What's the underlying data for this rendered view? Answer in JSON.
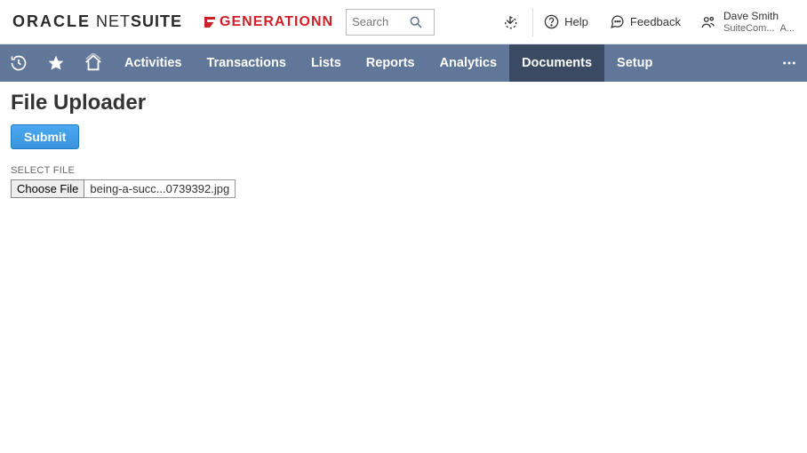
{
  "header": {
    "brand_oracle": "ORACLE",
    "brand_net": "NET",
    "brand_suite": "SUITE",
    "brand_partner": "GENERATIONN",
    "search_placeholder": "Search",
    "help_label": "Help",
    "feedback_label": "Feedback",
    "user_name": "Dave Smith",
    "user_company": "SuiteCom...",
    "user_role": "A..."
  },
  "nav": {
    "items": [
      {
        "label": "Activities",
        "active": false
      },
      {
        "label": "Transactions",
        "active": false
      },
      {
        "label": "Lists",
        "active": false
      },
      {
        "label": "Reports",
        "active": false
      },
      {
        "label": "Analytics",
        "active": false
      },
      {
        "label": "Documents",
        "active": true
      },
      {
        "label": "Setup",
        "active": false
      }
    ]
  },
  "page": {
    "title": "File Uploader",
    "submit_label": "Submit",
    "select_file_label": "SELECT FILE",
    "choose_file_label": "Choose File",
    "selected_file_name": "being-a-succ...0739392.jpg"
  }
}
